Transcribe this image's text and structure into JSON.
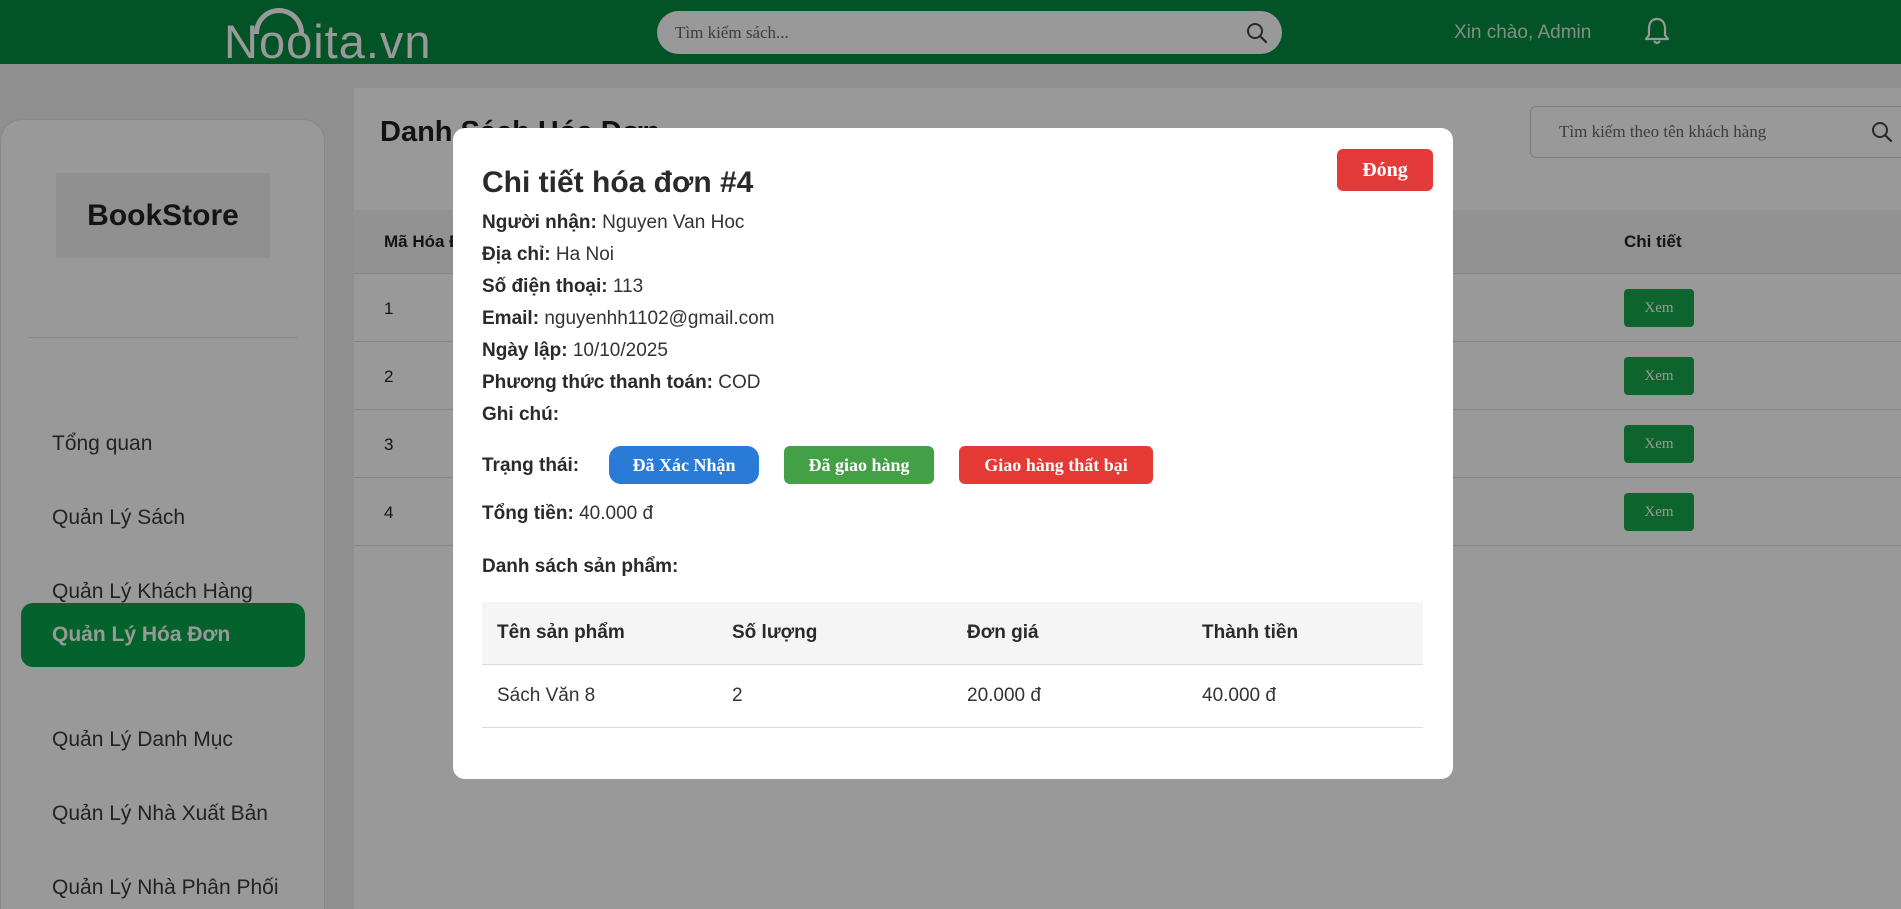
{
  "header": {
    "logo": "Nooita.vn",
    "search_placeholder": "Tìm kiếm sách...",
    "greeting": "Xin chào, Admin"
  },
  "sidebar": {
    "brand": "BookStore",
    "items": [
      {
        "label": "Tổng quan"
      },
      {
        "label": "Quản Lý Sách"
      },
      {
        "label": "Quản Lý Khách Hàng"
      },
      {
        "label": "Quản Lý Hóa Đơn",
        "active": true
      },
      {
        "label": "Quản Lý Danh Mục"
      },
      {
        "label": "Quản Lý Nhà Xuất Bản"
      },
      {
        "label": "Quản Lý Nhà Phân Phối"
      }
    ]
  },
  "main": {
    "title": "Danh Sách Hóa Đơn",
    "search_placeholder": "Tìm kiếm theo tên khách hàng",
    "columns": {
      "id": "Mã Hóa Đơn",
      "detail": "Chi tiết"
    },
    "rows": [
      {
        "id": "1",
        "action": "Xem"
      },
      {
        "id": "2",
        "action": "Xem"
      },
      {
        "id": "3",
        "action": "Xem"
      },
      {
        "id": "4",
        "action": "Xem"
      }
    ]
  },
  "modal": {
    "close_label": "Đóng",
    "title": "Chi tiết hóa đơn #4",
    "fields": [
      {
        "label": "Người nhận:",
        "value": "Nguyen Van Hoc"
      },
      {
        "label": "Địa chỉ:",
        "value": "Ha Noi"
      },
      {
        "label": "Số điện thoại:",
        "value": "113"
      },
      {
        "label": "Email:",
        "value": "nguyenhh1102@gmail.com"
      },
      {
        "label": "Ngày lập:",
        "value": "10/10/2025"
      },
      {
        "label": "Phương thức thanh toán:",
        "value": "COD"
      },
      {
        "label": "Ghi chú:",
        "value": ""
      }
    ],
    "status_label": "Trạng thái:",
    "status_buttons": {
      "confirmed": "Đã Xác Nhận",
      "delivered": "Đã giao hàng",
      "failed": "Giao hàng thất bại"
    },
    "total_label": "Tổng tiền:",
    "total_value": "40.000 đ",
    "products_title": "Danh sách sản phẩm:",
    "product_columns": [
      "Tên sản phẩm",
      "Số lượng",
      "Đơn giá",
      "Thành tiền"
    ],
    "products": [
      [
        "Sách Văn 8",
        "2",
        "20.000 đ",
        "40.000 đ"
      ]
    ]
  },
  "colors": {
    "brand_green": "#048a3e",
    "active_green": "#07a64a",
    "close_red": "#e43a3a",
    "confirm_blue": "#2a7bd8",
    "delivered_green": "#43a047",
    "failed_red": "#e53935"
  },
  "icons": [
    "search-icon",
    "bell-icon"
  ]
}
